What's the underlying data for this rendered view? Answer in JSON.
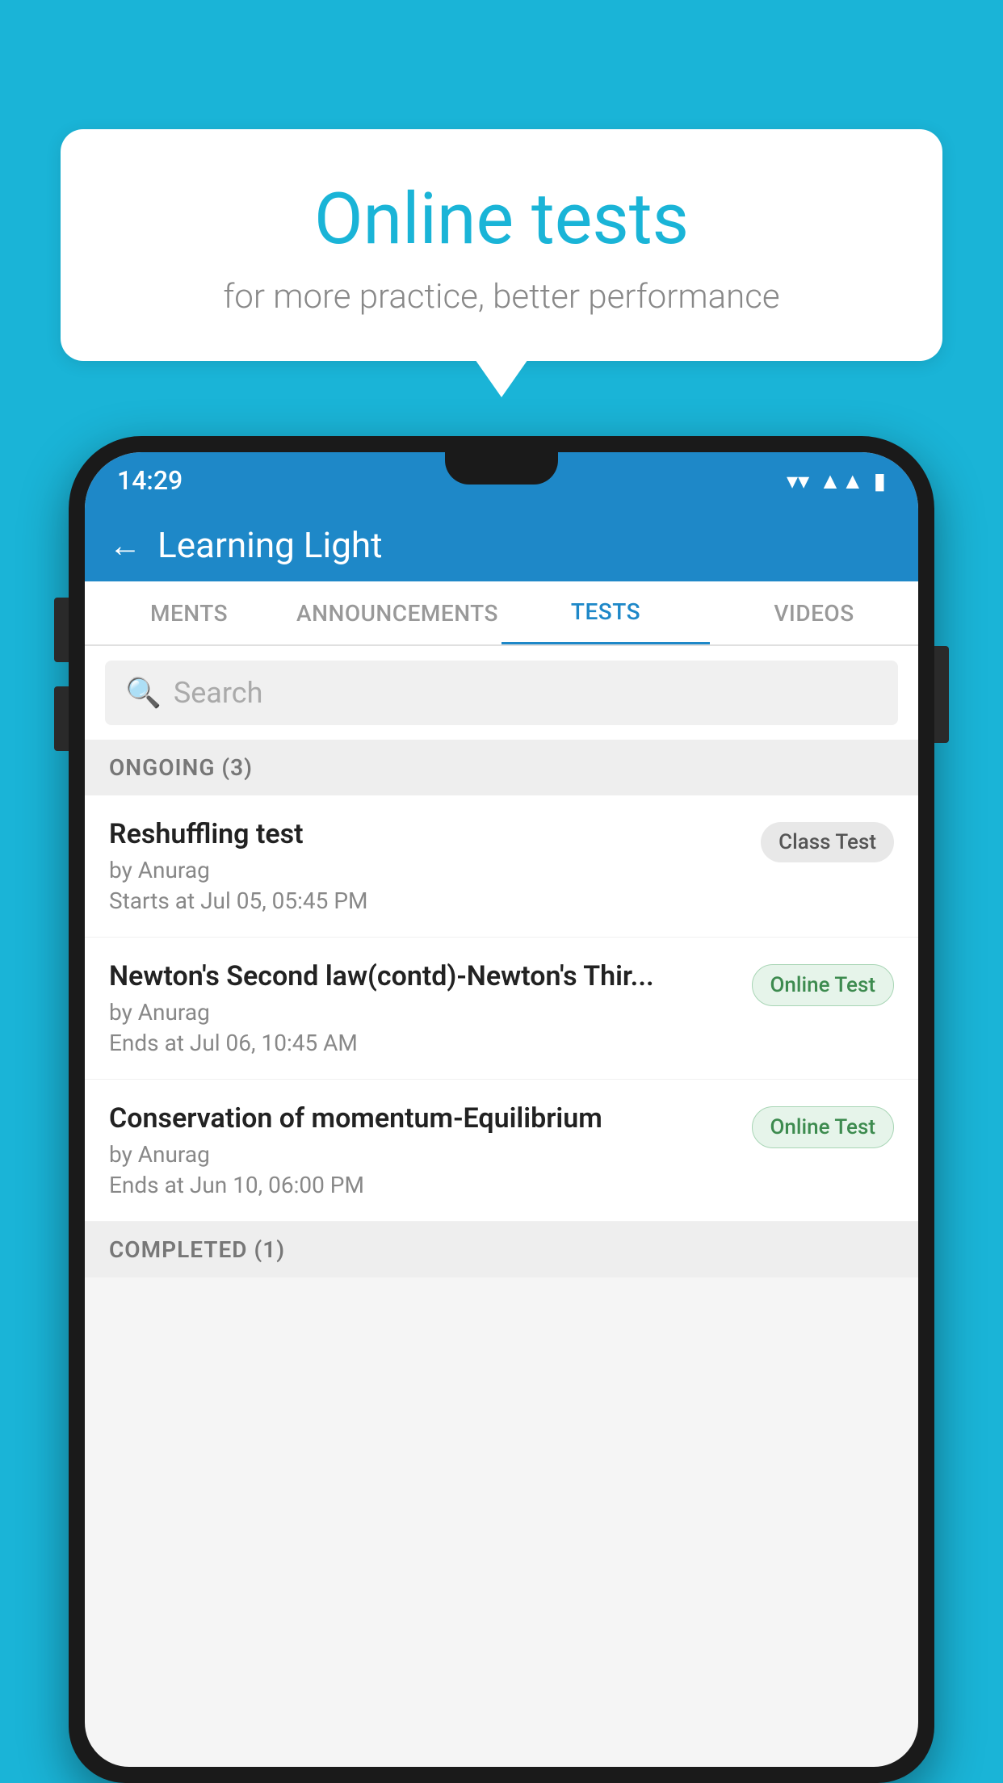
{
  "background_color": "#1ab4d7",
  "speech_bubble": {
    "title": "Online tests",
    "subtitle": "for more practice, better performance"
  },
  "phone": {
    "status_bar": {
      "time": "14:29",
      "icons": [
        "wifi",
        "signal",
        "battery"
      ]
    },
    "app_header": {
      "title": "Learning Light",
      "back_label": "←"
    },
    "tabs": [
      {
        "label": "MENTS",
        "active": false
      },
      {
        "label": "ANNOUNCEMENTS",
        "active": false
      },
      {
        "label": "TESTS",
        "active": true
      },
      {
        "label": "VIDEOS",
        "active": false
      }
    ],
    "search": {
      "placeholder": "Search"
    },
    "sections": [
      {
        "title": "ONGOING (3)",
        "items": [
          {
            "name": "Reshuffling test",
            "author": "by Anurag",
            "date": "Starts at  Jul 05, 05:45 PM",
            "badge": "Class Test",
            "badge_type": "class"
          },
          {
            "name": "Newton's Second law(contd)-Newton's Thir...",
            "author": "by Anurag",
            "date": "Ends at  Jul 06, 10:45 AM",
            "badge": "Online Test",
            "badge_type": "online"
          },
          {
            "name": "Conservation of momentum-Equilibrium",
            "author": "by Anurag",
            "date": "Ends at  Jun 10, 06:00 PM",
            "badge": "Online Test",
            "badge_type": "online"
          }
        ]
      }
    ],
    "completed_section": "COMPLETED (1)"
  }
}
